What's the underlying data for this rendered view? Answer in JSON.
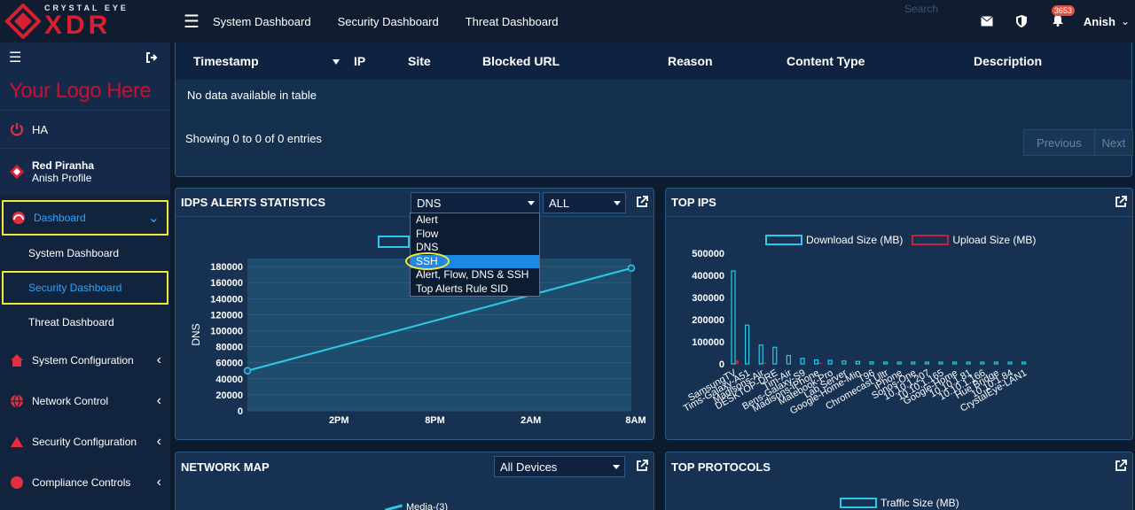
{
  "brand": {
    "top": "CRYSTAL EYE",
    "main": "XDR"
  },
  "sidebar": {
    "your_logo": "Your Logo Here",
    "ha": "HA",
    "profile_name": "Red Piranha",
    "profile_sub": "Anish Profile",
    "items": [
      {
        "label": "Dashboard"
      },
      {
        "label": "System Dashboard"
      },
      {
        "label": "Security Dashboard"
      },
      {
        "label": "Threat Dashboard"
      },
      {
        "label": "System Configuration"
      },
      {
        "label": "Network Control"
      },
      {
        "label": "Security Configuration"
      },
      {
        "label": "Compliance Controls"
      }
    ]
  },
  "topbar": {
    "tabs": [
      "System Dashboard",
      "Security Dashboard",
      "Threat Dashboard"
    ],
    "search_placeholder": "Search",
    "notif_count": "3653",
    "user": "Anish"
  },
  "table": {
    "columns": [
      "Timestamp",
      "IP",
      "Site",
      "Blocked URL",
      "Reason",
      "Content Type",
      "Description"
    ],
    "empty": "No data available in table",
    "info": "Showing 0 to 0 of 0 entries",
    "prev": "Previous",
    "next": "Next"
  },
  "idps": {
    "title": "IDPS ALERTS STATISTICS",
    "type_value": "DNS",
    "scope_value": "ALL",
    "options": [
      "Alert",
      "Flow",
      "DNS",
      "SSH",
      "Alert, Flow, DNS & SSH",
      "Top Alerts Rule SID"
    ],
    "selected_option": "SSH",
    "ylabel": "DNS"
  },
  "top_ips": {
    "title": "TOP IPS",
    "legend_download": "Download Size (MB)",
    "legend_upload": "Upload Size (MB)"
  },
  "network_map": {
    "title": "NETWORK MAP",
    "select": "All Devices",
    "legend_partial": "Media-(3)"
  },
  "top_protocols": {
    "title": "TOP PROTOCOLS",
    "legend": "Traffic Size (MB)"
  },
  "colors": {
    "accent": "#1e88e5",
    "brand_red": "#d92030",
    "line": "#2ec8e8",
    "highlight": "#f5e63a"
  },
  "chart_data": [
    {
      "type": "line",
      "ylabel": "DNS",
      "x": [
        "",
        "2PM",
        "8PM",
        "2AM",
        "8AM"
      ],
      "points": [
        {
          "x": 0,
          "y": 50000
        },
        {
          "x": 1,
          "y": 178000
        }
      ],
      "yticks": [
        0,
        20000,
        40000,
        60000,
        80000,
        100000,
        120000,
        140000,
        160000,
        180000
      ],
      "xticks": [
        "2PM",
        "8PM",
        "2AM",
        "8AM"
      ],
      "ylim": [
        0,
        190000
      ]
    },
    {
      "type": "bar",
      "categories": [
        "SamsungTV",
        "Tims-Galaxy-A51",
        "Madisons-Air",
        "DESKTOP-DRE",
        "Tim-Air",
        "Bens-Galaxy-S9",
        "Madisons-iPhone",
        "Matebook-Pro",
        "Lab Server",
        "Google-Home-Min",
        "T96",
        "Chromecast Ultr",
        "iPhone",
        "Sonos-One",
        "10.10.1.207",
        "10.10.1.165",
        "Google-Home",
        "10.10.1.81",
        "10.10.1.166",
        "Hue Bridge",
        "10.10.1.84",
        "CrystalEye-LAN1"
      ],
      "series": [
        {
          "name": "Download Size (MB)",
          "values": [
            420000,
            175000,
            85000,
            75000,
            38000,
            25000,
            18000,
            16000,
            13000,
            11000,
            9000,
            6000,
            5000,
            3000,
            1500,
            1000,
            800,
            600,
            500,
            400,
            300,
            200
          ]
        },
        {
          "name": "Upload Size (MB)",
          "values": [
            15000,
            0,
            3000,
            0,
            0,
            0,
            2000,
            0,
            0,
            0,
            0,
            0,
            0,
            0,
            0,
            0,
            0,
            0,
            0,
            0,
            0,
            0
          ]
        }
      ],
      "yticks": [
        0,
        100000,
        200000,
        300000,
        400000,
        500000
      ],
      "ylim": [
        0,
        500000
      ]
    }
  ]
}
